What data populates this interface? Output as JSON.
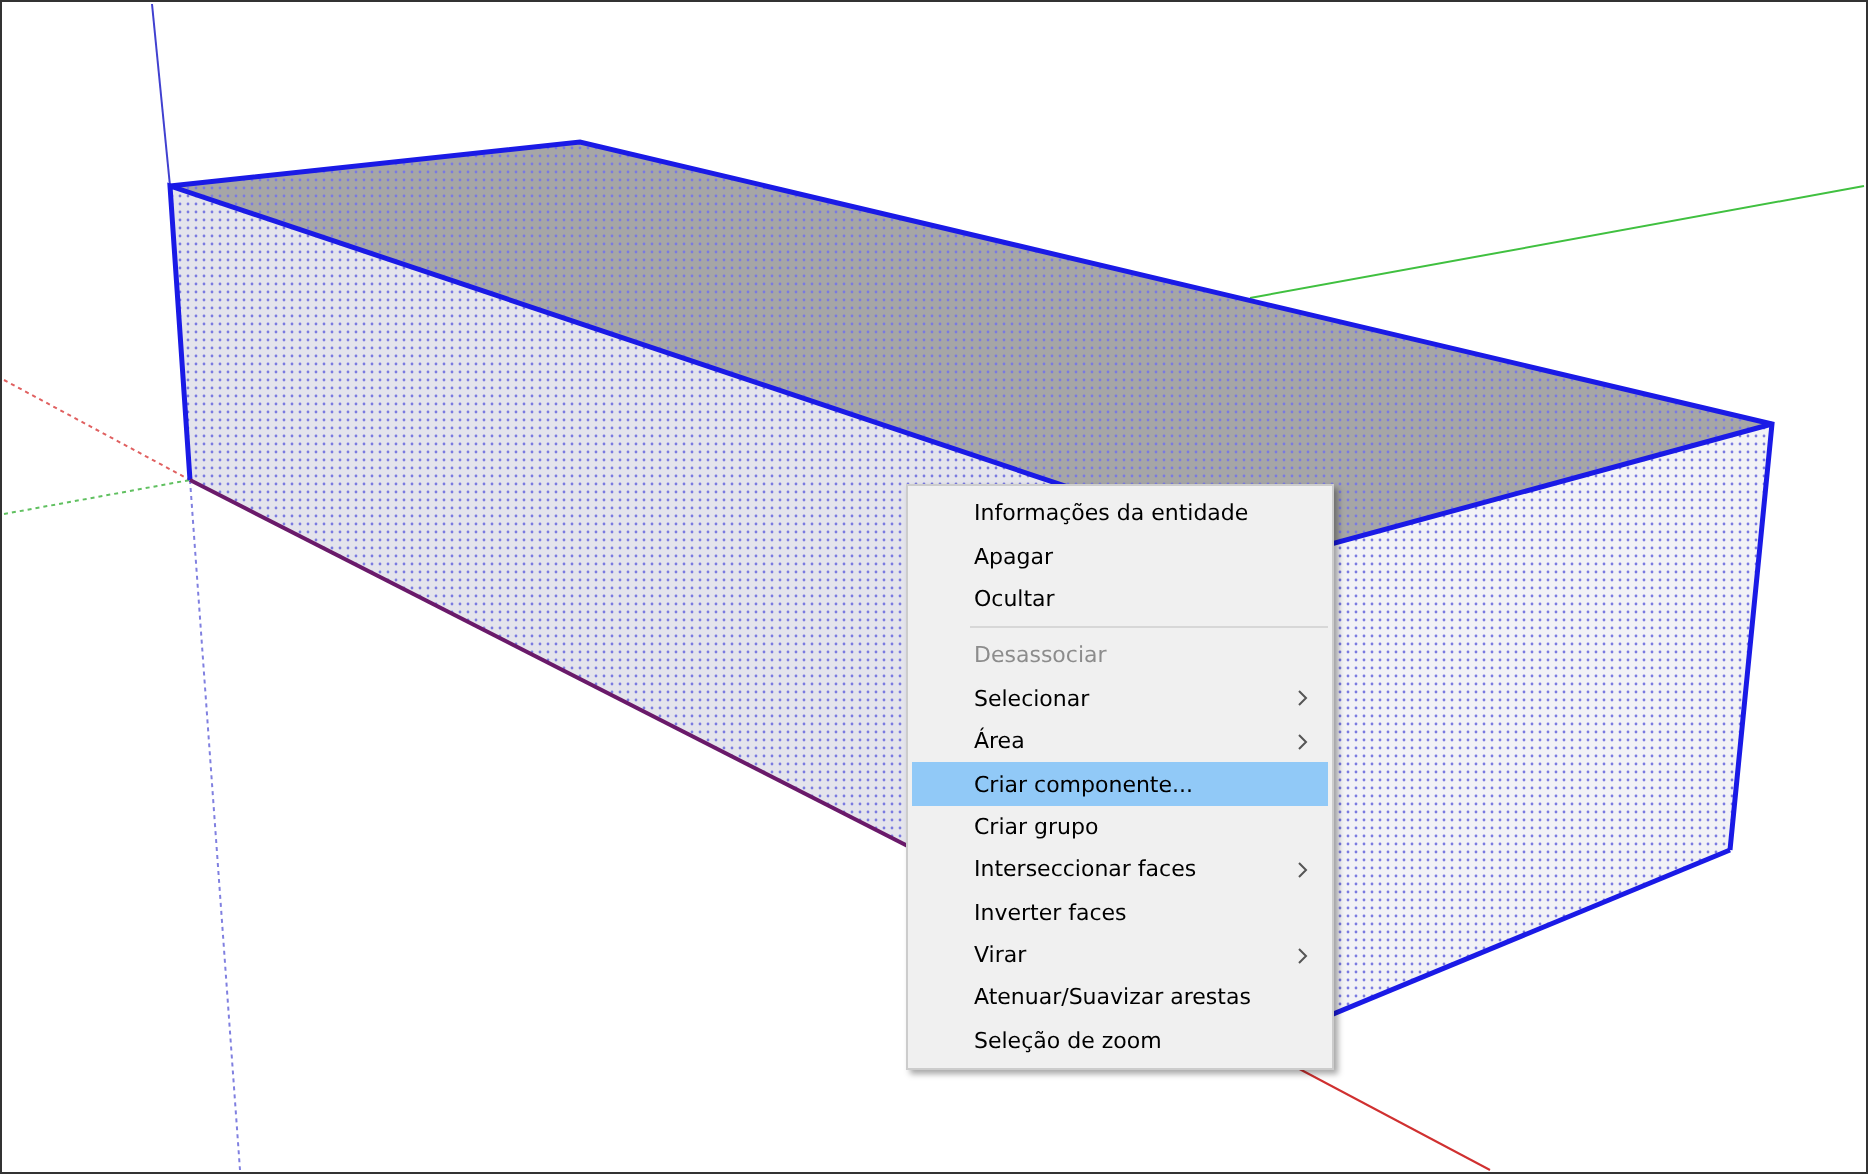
{
  "context_menu": {
    "items": [
      {
        "kind": "item",
        "label": "Informações da entidade",
        "disabled": false,
        "submenu": false,
        "selected": false
      },
      {
        "kind": "item",
        "label": "Apagar",
        "disabled": false,
        "submenu": false,
        "selected": false
      },
      {
        "kind": "item",
        "label": "Ocultar",
        "disabled": false,
        "submenu": false,
        "selected": false
      },
      {
        "kind": "separator"
      },
      {
        "kind": "item",
        "label": "Desassociar",
        "disabled": true,
        "submenu": false,
        "selected": false
      },
      {
        "kind": "item",
        "label": "Selecionar",
        "disabled": false,
        "submenu": true,
        "selected": false
      },
      {
        "kind": "item",
        "label": "Área",
        "disabled": false,
        "submenu": true,
        "selected": false
      },
      {
        "kind": "item",
        "label": "Criar componente...",
        "disabled": false,
        "submenu": false,
        "selected": true
      },
      {
        "kind": "item",
        "label": "Criar grupo",
        "disabled": false,
        "submenu": false,
        "selected": false
      },
      {
        "kind": "item",
        "label": "Interseccionar faces",
        "disabled": false,
        "submenu": true,
        "selected": false
      },
      {
        "kind": "item",
        "label": "Inverter faces",
        "disabled": false,
        "submenu": false,
        "selected": false
      },
      {
        "kind": "item",
        "label": "Virar",
        "disabled": false,
        "submenu": true,
        "selected": false
      },
      {
        "kind": "item",
        "label": "Atenuar/Suavizar arestas",
        "disabled": false,
        "submenu": false,
        "selected": false
      },
      {
        "kind": "item",
        "label": "Seleção de zoom",
        "disabled": false,
        "submenu": false,
        "selected": false
      }
    ]
  }
}
